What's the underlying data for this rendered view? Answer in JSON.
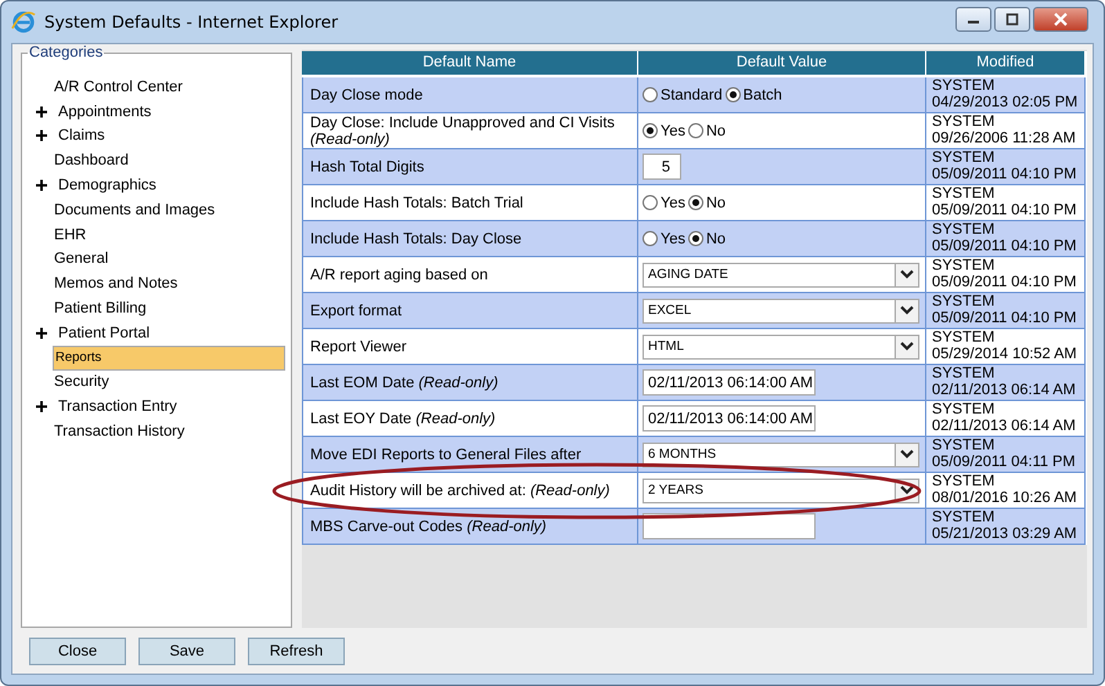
{
  "window": {
    "title": "System Defaults - Internet Explorer"
  },
  "sidebar": {
    "title": "Categories",
    "items": [
      {
        "label": "A/R Control Center",
        "has_children": false,
        "selected": false
      },
      {
        "label": "Appointments",
        "has_children": true,
        "selected": false
      },
      {
        "label": "Claims",
        "has_children": true,
        "selected": false
      },
      {
        "label": "Dashboard",
        "has_children": false,
        "selected": false
      },
      {
        "label": "Demographics",
        "has_children": true,
        "selected": false
      },
      {
        "label": "Documents and Images",
        "has_children": false,
        "selected": false
      },
      {
        "label": "EHR",
        "has_children": false,
        "selected": false
      },
      {
        "label": "General",
        "has_children": false,
        "selected": false
      },
      {
        "label": "Memos and Notes",
        "has_children": false,
        "selected": false
      },
      {
        "label": "Patient Billing",
        "has_children": false,
        "selected": false
      },
      {
        "label": "Patient Portal",
        "has_children": true,
        "selected": false
      },
      {
        "label": "Reports",
        "has_children": false,
        "selected": true
      },
      {
        "label": "Security",
        "has_children": false,
        "selected": false
      },
      {
        "label": "Transaction Entry",
        "has_children": true,
        "selected": false
      },
      {
        "label": "Transaction History",
        "has_children": false,
        "selected": false
      }
    ]
  },
  "table": {
    "columns": [
      "Default Name",
      "Default Value",
      "Modified"
    ],
    "rows": [
      {
        "name": "Day Close mode",
        "kind": "radio",
        "options": [
          {
            "label": "Standard",
            "selected": false
          },
          {
            "label": "Batch",
            "selected": true
          }
        ],
        "modified_by": "SYSTEM",
        "modified_at": "04/29/2013 02:05 PM"
      },
      {
        "name": "Day Close: Include Unapproved and CI Visits *(Read-only)*",
        "kind": "radio",
        "options": [
          {
            "label": "Yes",
            "selected": true
          },
          {
            "label": "No",
            "selected": false
          }
        ],
        "modified_by": "SYSTEM",
        "modified_at": "09/26/2006 11:28 AM"
      },
      {
        "name": "Hash Total Digits",
        "kind": "number",
        "value": "5",
        "modified_by": "SYSTEM",
        "modified_at": "05/09/2011 04:10 PM"
      },
      {
        "name": "Include Hash Totals: Batch Trial",
        "kind": "radio",
        "options": [
          {
            "label": "Yes",
            "selected": false
          },
          {
            "label": "No",
            "selected": true
          }
        ],
        "modified_by": "SYSTEM",
        "modified_at": "05/09/2011 04:10 PM"
      },
      {
        "name": "Include Hash Totals: Day Close",
        "kind": "radio",
        "options": [
          {
            "label": "Yes",
            "selected": false
          },
          {
            "label": "No",
            "selected": true
          }
        ],
        "modified_by": "SYSTEM",
        "modified_at": "05/09/2011 04:10 PM"
      },
      {
        "name": "A/R report aging based on",
        "kind": "select",
        "value": "AGING DATE",
        "modified_by": "SYSTEM",
        "modified_at": "05/09/2011 04:10 PM"
      },
      {
        "name": "Export format",
        "kind": "select",
        "value": "EXCEL",
        "modified_by": "SYSTEM",
        "modified_at": "05/09/2011 04:10 PM"
      },
      {
        "name": "Report Viewer",
        "kind": "select",
        "value": "HTML",
        "modified_by": "SYSTEM",
        "modified_at": "05/29/2014 10:52 AM"
      },
      {
        "name": "Last EOM Date *(Read-only)*",
        "kind": "text",
        "value": "02/11/2013 06:14:00 AM",
        "modified_by": "SYSTEM",
        "modified_at": "02/11/2013 06:14 AM"
      },
      {
        "name": "Last EOY Date *(Read-only)*",
        "kind": "text",
        "value": "02/11/2013 06:14:00 AM",
        "modified_by": "SYSTEM",
        "modified_at": "02/11/2013 06:14 AM"
      },
      {
        "name": "Move EDI Reports to General Files after",
        "kind": "select",
        "value": "6 MONTHS",
        "modified_by": "SYSTEM",
        "modified_at": "05/09/2011 04:11 PM"
      },
      {
        "name": "Audit History will be archived at: *(Read-only)*",
        "kind": "select",
        "value": "2 YEARS",
        "modified_by": "SYSTEM",
        "modified_at": "08/01/2016 10:26 AM"
      },
      {
        "name": "MBS Carve-out Codes *(Read-only)*",
        "kind": "text",
        "value": "",
        "modified_by": "SYSTEM",
        "modified_at": "05/21/2013 03:29 AM"
      }
    ]
  },
  "buttons": [
    "Close",
    "Save",
    "Refresh"
  ]
}
